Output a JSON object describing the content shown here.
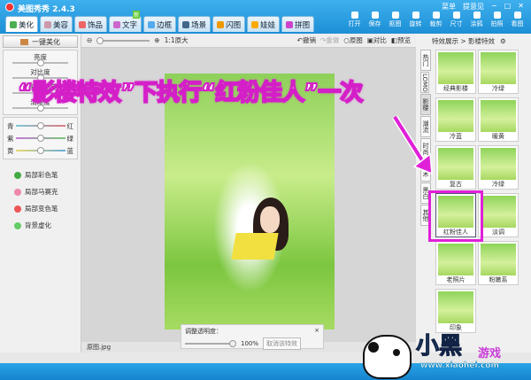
{
  "app": {
    "title": "美图秀秀 2.4.3",
    "menu": "菜单",
    "feedback": "提意见",
    "minimize": "−",
    "maximize": "□",
    "close": "✕"
  },
  "tabs": [
    {
      "label": "美化",
      "color": "#4caf50"
    },
    {
      "label": "美容",
      "color": "#c9a"
    },
    {
      "label": "饰品",
      "color": "#e66"
    },
    {
      "label": "文字",
      "color": "#c6c"
    },
    {
      "label": "边框",
      "color": "#5ae"
    },
    {
      "label": "场景",
      "color": "#468"
    },
    {
      "label": "闪图",
      "color": "#e90"
    },
    {
      "label": "娃娃",
      "color": "#fa0"
    },
    {
      "label": "拼图",
      "color": "#c4c"
    }
  ],
  "new_badge": "新",
  "tools": [
    "打开",
    "保存",
    "抠图",
    "旋转",
    "裁剪",
    "尺寸",
    "涂鸦",
    "拍照",
    "看图"
  ],
  "left": {
    "one_key": "一键美化",
    "sliders": [
      "亮度",
      "对比度",
      "色彩饱和度",
      "清晰度"
    ],
    "color_sliders": [
      {
        "l": "青",
        "r": "红"
      },
      {
        "l": "紫",
        "r": "绿"
      },
      {
        "l": "黄",
        "r": "蓝"
      }
    ],
    "tools": [
      {
        "label": "局部彩色笔",
        "color": "#4a4"
      },
      {
        "label": "局部马赛克",
        "color": "#e8a"
      },
      {
        "label": "局部变色笔",
        "color": "#e55"
      },
      {
        "label": "背景虚化",
        "color": "#6c6"
      }
    ]
  },
  "canvas": {
    "zoom_label": "1:1原大",
    "undo": "撤销",
    "redo": "重做",
    "original": "原图",
    "compare": "对比",
    "preview": "预览",
    "opacity_label": "调整透明度：",
    "opacity_value": "100%",
    "opacity_fraction": 1.0,
    "cancel_effect": "取消该特效",
    "filename": "原图.jpg",
    "dimensions": "400 × 600"
  },
  "right": {
    "breadcrumb": "特效展示 > 影楼特效",
    "vtabs": [
      "热门",
      "LOMO",
      "影楼",
      "潮流",
      "时尚",
      "艺术",
      "黑白",
      "其他"
    ],
    "effects": [
      "经典影楼",
      "冷绿",
      "冷蓝",
      "暖黄",
      "复古",
      "冷绿",
      "红粉佳人",
      "淡调",
      "老照片",
      "粉嫩系",
      "印象"
    ]
  },
  "annotation": "“影楼特效”下执行“红粉佳人”一次",
  "watermark": {
    "brand": "小黑",
    "brand2": "游戏",
    "url": "www.xiaohei.com"
  }
}
